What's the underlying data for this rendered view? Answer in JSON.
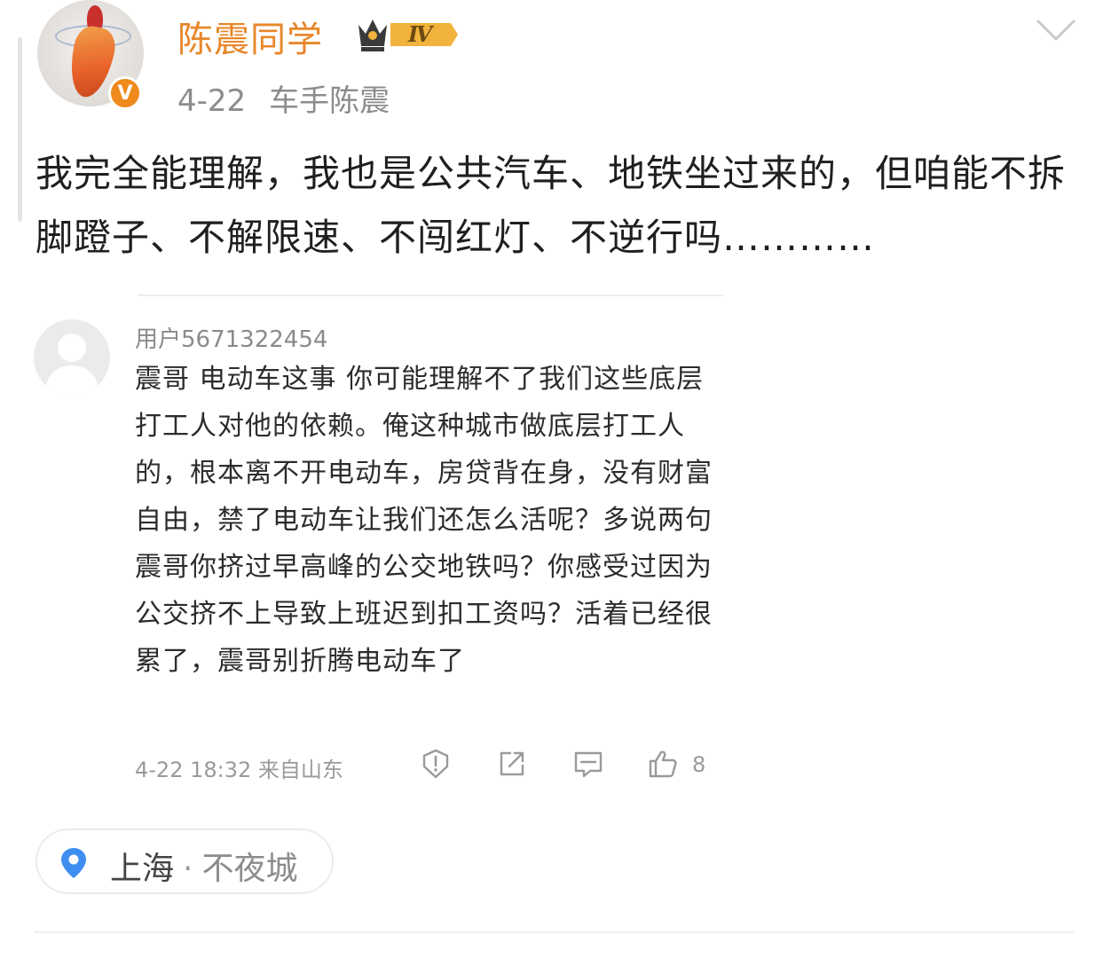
{
  "post": {
    "username": "陈震同学",
    "level_badge": "Ⅳ",
    "verified_mark": "V",
    "date": "4-22",
    "source": "车手陈震",
    "body": "我完全能理解，我也是公共汽车、地铁坐过来的，但咱能不拆脚蹬子、不解限速、不闯红灯、不逆行吗…………"
  },
  "quoted_comment": {
    "username": "用户5671322454",
    "body": "震哥 电动车这事 你可能理解不了我们这些底层打工人对他的依赖。俺这种城市做底层打工人的，根本离不开电动车，房贷背在身，没有财富自由，禁了电动车让我们还怎么活呢？多说两句震哥你挤过早高峰的公交地铁吗？你感受过因为公交挤不上导致上班迟到扣工资吗？活着已经很累了，震哥别折腾电动车了",
    "time_location": "4-22 18:32 来自山东",
    "like_count": "8",
    "icons": [
      "report-icon",
      "share-icon",
      "comment-icon",
      "like-icon"
    ]
  },
  "location": {
    "city": "上海",
    "separator": "·",
    "place": "不夜城"
  },
  "colors": {
    "username": "#e8872a",
    "verified_badge": "#f08a1c",
    "location_pin": "#3d8ef0",
    "level_badge": "#f2b33c"
  }
}
